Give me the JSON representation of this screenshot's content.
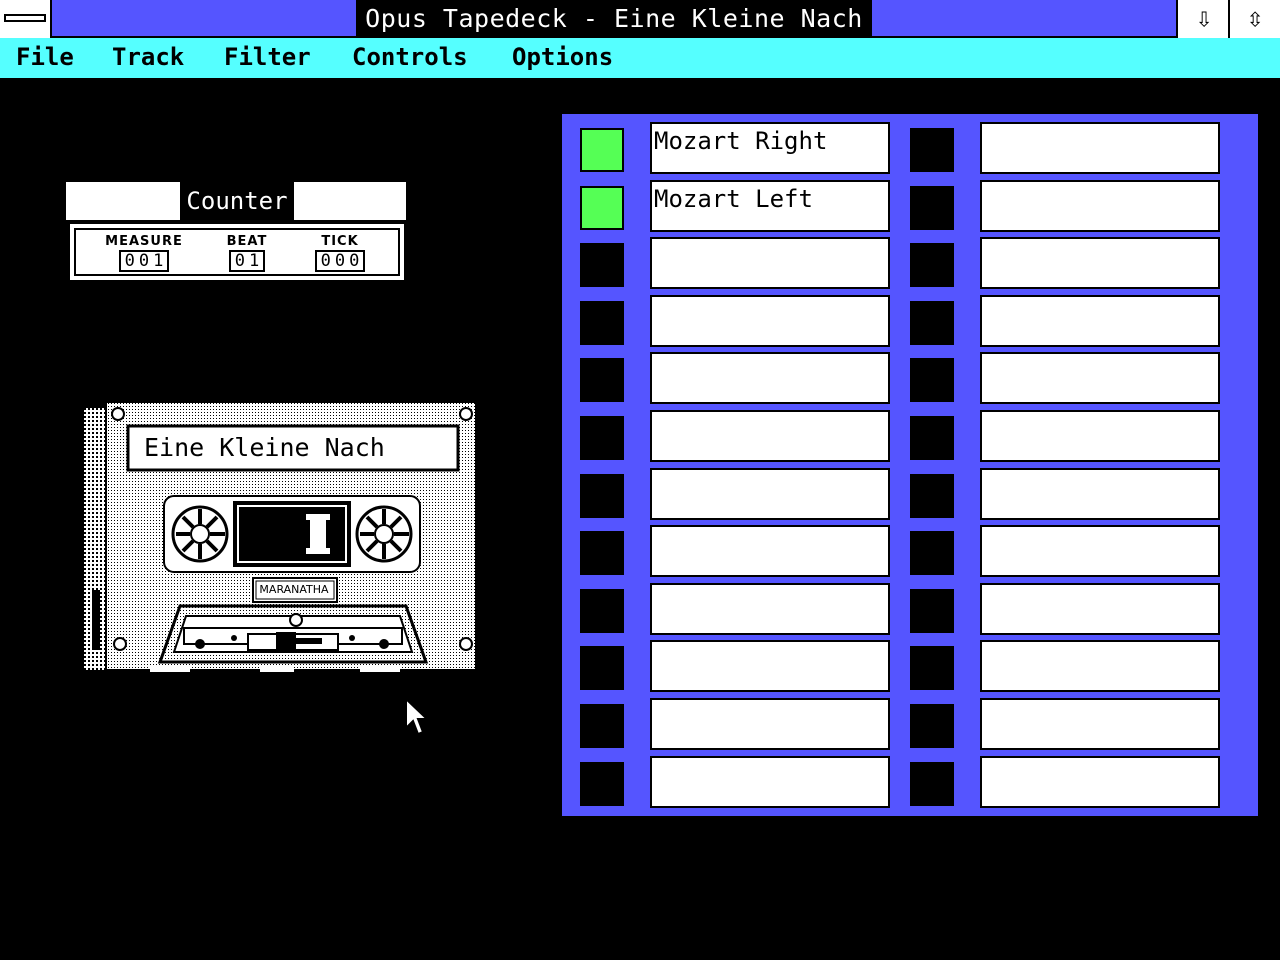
{
  "window": {
    "title": "Opus Tapedeck - Eine Kleine Nach",
    "minimize_icon": "down-arrow-icon",
    "restore_icon": "up-down-arrow-icon"
  },
  "menu": [
    "File",
    "Track",
    "Filter",
    "Controls",
    "Options"
  ],
  "counter": {
    "title": "Counter",
    "measure_label": "MEASURE",
    "measure_value": "001",
    "beat_label": "BEAT",
    "beat_value": "01",
    "tick_label": "TICK",
    "tick_value": "000"
  },
  "cassette": {
    "label": "Eine Kleine Nach",
    "brand": "MARANATHA"
  },
  "tracks": {
    "left": [
      {
        "name": "Mozart Right",
        "active": true
      },
      {
        "name": "Mozart Left",
        "active": true
      },
      {
        "name": "",
        "active": false
      },
      {
        "name": "",
        "active": false
      },
      {
        "name": "",
        "active": false
      },
      {
        "name": "",
        "active": false
      },
      {
        "name": "",
        "active": false
      },
      {
        "name": "",
        "active": false
      },
      {
        "name": "",
        "active": false
      },
      {
        "name": "",
        "active": false
      },
      {
        "name": "",
        "active": false
      },
      {
        "name": "",
        "active": false
      }
    ],
    "right": [
      {
        "name": "",
        "active": false
      },
      {
        "name": "",
        "active": false
      },
      {
        "name": "",
        "active": false
      },
      {
        "name": "",
        "active": false
      },
      {
        "name": "",
        "active": false
      },
      {
        "name": "",
        "active": false
      },
      {
        "name": "",
        "active": false
      },
      {
        "name": "",
        "active": false
      },
      {
        "name": "",
        "active": false
      },
      {
        "name": "",
        "active": false
      },
      {
        "name": "",
        "active": false
      },
      {
        "name": "",
        "active": false
      }
    ]
  },
  "colors": {
    "titlebar": "#5555ff",
    "menubar": "#55ffff",
    "track_panel": "#5555ff",
    "track_active": "#55ff55",
    "desktop": "#000000"
  }
}
